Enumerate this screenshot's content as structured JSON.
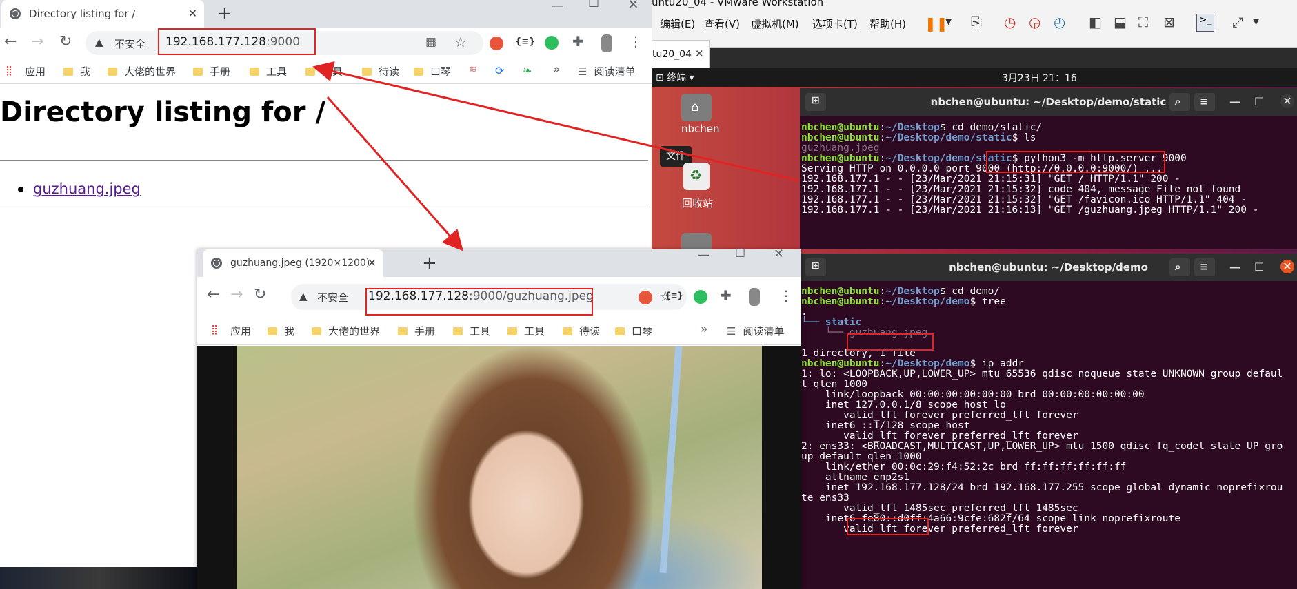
{
  "browser1": {
    "tab_title": "Directory listing for /",
    "security_label": "不安全",
    "url_host": "192.168.177.128",
    "url_path": ":9000",
    "bookmarks": [
      "应用",
      "我",
      "大佬的世界",
      "手册",
      "工具",
      "工具",
      "待读",
      "口琴"
    ],
    "more_bookmarks": "»",
    "reading_list": "阅读清单",
    "heading": "Directory listing for /",
    "files": [
      "guzhuang.jpeg"
    ]
  },
  "browser2": {
    "tab_title": "guzhuang.jpeg (1920×1200)",
    "security_label": "不安全",
    "url_host": "192.168.177.128",
    "url_path": ":9000/guzhuang.jpeg",
    "bookmarks": [
      "应用",
      "我",
      "大佬的世界",
      "手册",
      "工具",
      "工具",
      "待读",
      "口琴"
    ],
    "more_bookmarks": "»",
    "reading_list": "阅读清单"
  },
  "vmware": {
    "title_fragment": "untu20_04 - VMware Workstation",
    "menu": [
      "编辑(E)",
      "查看(V)",
      "虚拟机(M)",
      "选项卡(T)",
      "帮助(H)"
    ],
    "vm_tab": "tu20_04",
    "activity_label": "终端",
    "clock": "3月23日 21：16",
    "desktop_icons": [
      "nbchen",
      "回收站"
    ],
    "tooltip": "文件"
  },
  "terminal1": {
    "title": "nbchen@ubuntu: ~/Desktop/demo/static",
    "lines": [
      {
        "user": "nbchen@ubuntu",
        "path": "~/Desktop",
        "cmd": " cd demo/static/"
      },
      {
        "user": "nbchen@ubuntu",
        "path": "~/Desktop/demo/static",
        "cmd": " ls"
      },
      {
        "text": "guzhuang.jpeg"
      },
      {
        "user": "nbchen@ubuntu",
        "path": "~/Desktop/demo/static",
        "cmd": " python3 -m http.server 9000"
      },
      {
        "text": "Serving HTTP on 0.0.0.0 port 9000 (http://0.0.0.0:9000/) ..."
      },
      {
        "text": "192.168.177.1 - - [23/Mar/2021 21:15:31] \"GET / HTTP/1.1\" 200 -"
      },
      {
        "text": "192.168.177.1 - - [23/Mar/2021 21:15:32] code 404, message File not found"
      },
      {
        "text": "192.168.177.1 - - [23/Mar/2021 21:15:32] \"GET /favicon.ico HTTP/1.1\" 404 -"
      },
      {
        "text": "192.168.177.1 - - [23/Mar/2021 21:16:13] \"GET /guzhuang.jpeg HTTP/1.1\" 200 -"
      }
    ]
  },
  "terminal2": {
    "title": "nbchen@ubuntu: ~/Desktop/demo",
    "lines": [
      {
        "user": "nbchen@ubuntu",
        "path": "~/Desktop",
        "cmd": " cd demo/"
      },
      {
        "user": "nbchen@ubuntu",
        "path": "~/Desktop/demo",
        "cmd": " tree"
      },
      {
        "text": "."
      },
      {
        "text": "└── static"
      },
      {
        "text": "    └── guzhuang.jpeg"
      },
      {
        "text": ""
      },
      {
        "text": "1 directory, 1 file"
      },
      {
        "user": "nbchen@ubuntu",
        "path": "~/Desktop/demo",
        "cmd": " ip addr"
      },
      {
        "text": "1: lo: <LOOPBACK,UP,LOWER_UP> mtu 65536 qdisc noqueue state UNKNOWN group defaul"
      },
      {
        "text": "t qlen 1000"
      },
      {
        "text": "    link/loopback 00:00:00:00:00:00 brd 00:00:00:00:00:00"
      },
      {
        "text": "    inet 127.0.0.1/8 scope host lo"
      },
      {
        "text": "       valid_lft forever preferred_lft forever"
      },
      {
        "text": "    inet6 ::1/128 scope host"
      },
      {
        "text": "       valid_lft forever preferred_lft forever"
      },
      {
        "text": "2: ens33: <BROADCAST,MULTICAST,UP,LOWER_UP> mtu 1500 qdisc fq_codel state UP gro"
      },
      {
        "text": "up default qlen 1000"
      },
      {
        "text": "    link/ether 00:0c:29:f4:52:2c brd ff:ff:ff:ff:ff:ff"
      },
      {
        "text": "    altname enp2s1"
      },
      {
        "text": "    inet 192.168.177.128/24 brd 192.168.177.255 scope global dynamic noprefixrou"
      },
      {
        "text": "te ens33"
      },
      {
        "text": "       valid_lft 1485sec preferred_lft 1485sec"
      },
      {
        "text": "    inet6 fe80::d0ff:4a66:9cfe:682f/64 scope link noprefixroute"
      },
      {
        "text": "       valid_lft forever preferred_lft forever"
      }
    ]
  },
  "annotation_color": "#e02424"
}
